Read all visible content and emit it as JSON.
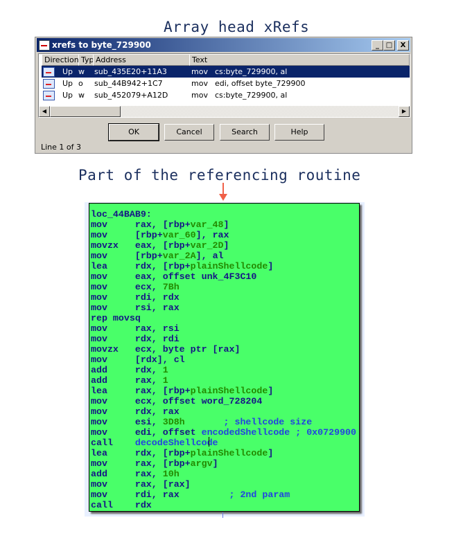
{
  "headings": {
    "top": "Array head xRefs",
    "middle": "Part of the referencing routine"
  },
  "dialog": {
    "title": "xrefs to byte_729900",
    "columns": [
      "Direction",
      "Typ",
      "Address",
      "Text"
    ],
    "rows": [
      {
        "direction": "Up",
        "type": "w",
        "address": "sub_435E20+11A3",
        "mnemonic": "mov",
        "operands": "cs:byte_729900, al",
        "selected": true
      },
      {
        "direction": "Up",
        "type": "o",
        "address": "sub_44B942+1C7",
        "mnemonic": "mov",
        "operands": "edi, offset byte_729900",
        "selected": false
      },
      {
        "direction": "Up",
        "type": "w",
        "address": "sub_452079+A12D",
        "mnemonic": "mov",
        "operands": "cs:byte_729900, al",
        "selected": false
      }
    ],
    "buttons": {
      "ok": "OK",
      "cancel": "Cancel",
      "search": "Search",
      "help": "Help"
    },
    "status": "Line 1 of 3",
    "window_buttons": {
      "minimize": "_",
      "maximize": "□",
      "close": "X"
    }
  },
  "code": {
    "background": "#49ff69",
    "lines": [
      [
        [
          "k",
          "loc_44BAB9:"
        ]
      ],
      [
        [
          "k",
          "mov     rax, [rbp+"
        ],
        [
          "g",
          "var_48"
        ],
        [
          "k",
          "]"
        ]
      ],
      [
        [
          "k",
          "mov     [rbp+"
        ],
        [
          "g",
          "var_60"
        ],
        [
          "k",
          "], rax"
        ]
      ],
      [
        [
          "k",
          "movzx   eax, [rbp+"
        ],
        [
          "g",
          "var_2D"
        ],
        [
          "k",
          "]"
        ]
      ],
      [
        [
          "k",
          "mov     [rbp+"
        ],
        [
          "g",
          "var_2A"
        ],
        [
          "k",
          "], al"
        ]
      ],
      [
        [
          "k",
          "lea     rdx, [rbp+"
        ],
        [
          "g",
          "plainShellcode"
        ],
        [
          "k",
          "]"
        ]
      ],
      [
        [
          "k",
          "mov     eax, offset unk_4F3C10"
        ]
      ],
      [
        [
          "k",
          "mov     ecx, "
        ],
        [
          "g",
          "7Bh"
        ]
      ],
      [
        [
          "k",
          "mov     rdi, rdx"
        ]
      ],
      [
        [
          "k",
          "mov     rsi, rax"
        ]
      ],
      [
        [
          "k",
          "rep movsq"
        ]
      ],
      [
        [
          "k",
          "mov     rax, rsi"
        ]
      ],
      [
        [
          "k",
          "mov     rdx, rdi"
        ]
      ],
      [
        [
          "k",
          "movzx   ecx, byte ptr [rax]"
        ]
      ],
      [
        [
          "k",
          "mov     [rdx], cl"
        ]
      ],
      [
        [
          "k",
          "add     rdx, "
        ],
        [
          "g",
          "1"
        ]
      ],
      [
        [
          "k",
          "add     rax, "
        ],
        [
          "g",
          "1"
        ]
      ],
      [
        [
          "k",
          "lea     rax, [rbp+"
        ],
        [
          "g",
          "plainShellcode"
        ],
        [
          "k",
          "]"
        ]
      ],
      [
        [
          "k",
          "mov     ecx, offset word_728204"
        ]
      ],
      [
        [
          "k",
          "mov     rdx, rax"
        ]
      ],
      [
        [
          "k",
          "mov     esi, "
        ],
        [
          "g",
          "3D8h"
        ],
        [
          "b",
          "       ; shellcode size"
        ]
      ],
      [
        [
          "k",
          "mov     edi, offset "
        ],
        [
          "b",
          "encodedShellcode ; 0x0729900"
        ]
      ],
      [
        [
          "k",
          "call    "
        ],
        [
          "b",
          "decodeShellcode"
        ]
      ],
      [
        [
          "k",
          "lea     rdx, [rbp+"
        ],
        [
          "g",
          "plainShellcode"
        ],
        [
          "k",
          "]"
        ]
      ],
      [
        [
          "k",
          "mov     rax, [rbp+"
        ],
        [
          "g",
          "argv"
        ],
        [
          "k",
          "]"
        ]
      ],
      [
        [
          "k",
          "add     rax, "
        ],
        [
          "g",
          "10h"
        ]
      ],
      [
        [
          "k",
          "mov     rax, [rax]"
        ]
      ],
      [
        [
          "k",
          "mov     rdi, rax"
        ],
        [
          "b",
          "         ; 2nd param"
        ]
      ],
      [
        [
          "k",
          "call    rdx"
        ]
      ]
    ]
  }
}
